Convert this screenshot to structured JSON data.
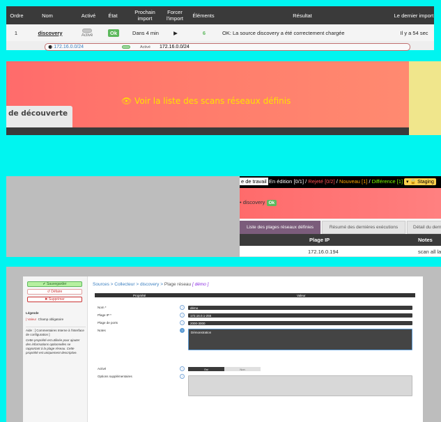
{
  "collector_table": {
    "headers": {
      "order": "Ordre",
      "name": "Nom",
      "active": "Activé",
      "state": "État",
      "next_import": "Prochain import",
      "force_import": "Forcer l'import",
      "elements": "Éléments",
      "result": "Résultat",
      "last_import": "Le dernier import"
    },
    "row": {
      "order": "1",
      "name": "discovery",
      "active_label": "Activé",
      "state": "Ok",
      "next_import": "Dans 4 min",
      "play_icon": "▶",
      "elements": "6",
      "result": "OK: La source discovery a été correctement chargée",
      "last_import": "Il y a 54 sec"
    },
    "subrow": {
      "range_link": "172.16.0.0/24",
      "active_label": "Activé",
      "range_value": "172.16.0.0/24"
    }
  },
  "banner": {
    "link_text": "👁 Voir la liste des scans réseaux définis",
    "tab_label": "de découverte",
    "link_color": "#ffe000"
  },
  "range_list": {
    "topbar": {
      "workspace": "e de travail",
      "editing": "En édition [0/1]",
      "sep1": " / ",
      "rejected": "Rejeté [0/2]",
      "sep2": " / ",
      "new": "Nouveau [1]",
      "sep3": " / ",
      "diff": "Différence [1]",
      "staging": "Staging"
    },
    "crumb": "discovery",
    "crumb_badge": "Ok",
    "tabs": [
      "Liste des plages réseaux définies",
      "Résumé des dernières exécutions",
      "Détail du derni"
    ],
    "headers": {
      "ip": "Plage IP",
      "notes": "Notes"
    },
    "row": {
      "ip": "172.16.0.194",
      "notes": "scan all la"
    }
  },
  "form": {
    "buttons": {
      "save": "✔ Sauvegarder",
      "reset": "↺ Défaire",
      "delete": "✖ Supprimer"
    },
    "legend": {
      "title": "Légende",
      "field": "| Valeur",
      "required": "Champ obligatoire"
    },
    "help_title": "Aide : [ Commentaires Interne à l'interface de configuration ]",
    "help_text": "Cette propriété est utilisée pour ajouter des informations optionnelles se rapportant à la plage réseau. Cette propriété est uniquement descriptive.",
    "breadcrumb": {
      "sources": "Sources",
      "collector": "Collecteur",
      "discovery": "discovery",
      "range": "Plage réseau",
      "current": "[ démo ]",
      "sep": " > "
    },
    "headers": {
      "property": "Propriété",
      "value": "Valeur"
    },
    "fields": {
      "name_label": "Nom *",
      "name_value": "démo",
      "ip_label": "Plage IP *",
      "ip_value": "172.16.0.1-255",
      "ports_label": "Plage de ports",
      "ports_value": "2000-3000",
      "notes_label": "Notes",
      "notes_value": "Démonstration",
      "active_label": "Activé",
      "active_yes": "Oui",
      "active_no": "Non",
      "extra_label": "Options supplémentaires"
    }
  }
}
